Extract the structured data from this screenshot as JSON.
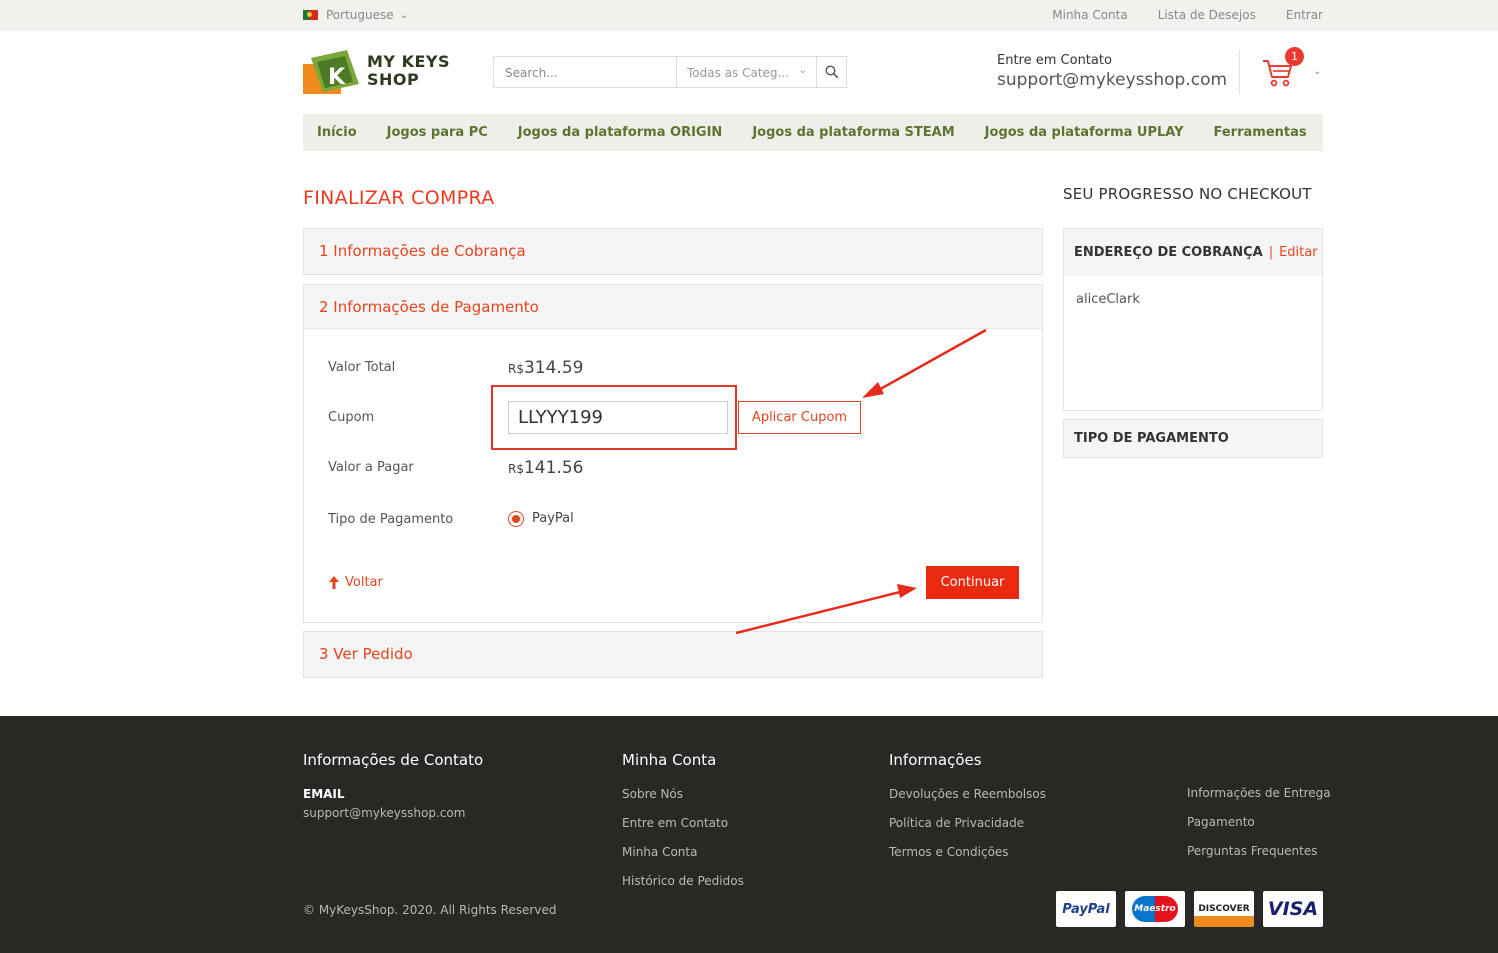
{
  "topbar": {
    "language": "Portuguese",
    "links": [
      "Minha Conta",
      "Lista de Desejos",
      "Entrar"
    ]
  },
  "header": {
    "logo_line1": "MY KEYS",
    "logo_line2": "SHOP",
    "logo_letter": "K",
    "search_placeholder": "Search...",
    "category": "Todas as Categ...",
    "contact_label": "Entre em Contato",
    "contact_email": "support@mykeysshop.com",
    "cart_count": "1"
  },
  "nav": [
    "Início",
    "Jogos para PC",
    "Jogos da plataforma ORIGIN",
    "Jogos da plataforma STEAM",
    "Jogos da plataforma UPLAY",
    "Ferramentas"
  ],
  "checkout": {
    "title": "FINALIZAR COMPRA",
    "step1": "1 Informações de Cobrança",
    "step2": "2 Informações de Pagamento",
    "step3": "3 Ver Pedido",
    "total_label": "Valor Total",
    "currency": "R$",
    "total_value": "314.59",
    "coupon_label": "Cupom",
    "coupon_value": "LLYYY199",
    "apply_label": "Aplicar Cupom",
    "pay_label": "Valor a Pagar",
    "pay_value": "141.56",
    "payment_type_label": "Tipo de Pagamento",
    "payment_option": "PayPal",
    "back_label": "Voltar",
    "continue_label": "Continuar"
  },
  "sidebar": {
    "title": "SEU PROGRESSO NO CHECKOUT",
    "billing_title": "ENDEREÇO DE COBRANÇA",
    "separator": "|",
    "edit_label": "Editar",
    "billing_name": "aliceClark",
    "payment_title": "TIPO DE PAGAMENTO"
  },
  "footer": {
    "contact_title": "Informações de Contato",
    "email_label": "EMAIL",
    "email": "support@mykeysshop.com",
    "account_title": "Minha Conta",
    "account_links": [
      "Sobre Nós",
      "Entre em Contato",
      "Minha Conta",
      "Histórico de Pedidos"
    ],
    "info_title": "Informações",
    "info_links": [
      "Devoluções e Reembolsos",
      "Política de Privacidade",
      "Termos e Condições"
    ],
    "info_links2": [
      "Informações de Entrega",
      "Pagamento",
      "Perguntas Frequentes"
    ],
    "copyright": "© MyKeysShop. 2020. All Rights Reserved",
    "payment_icons": [
      "PayPal",
      "Maestro",
      "DISCOVER",
      "VISA"
    ]
  }
}
